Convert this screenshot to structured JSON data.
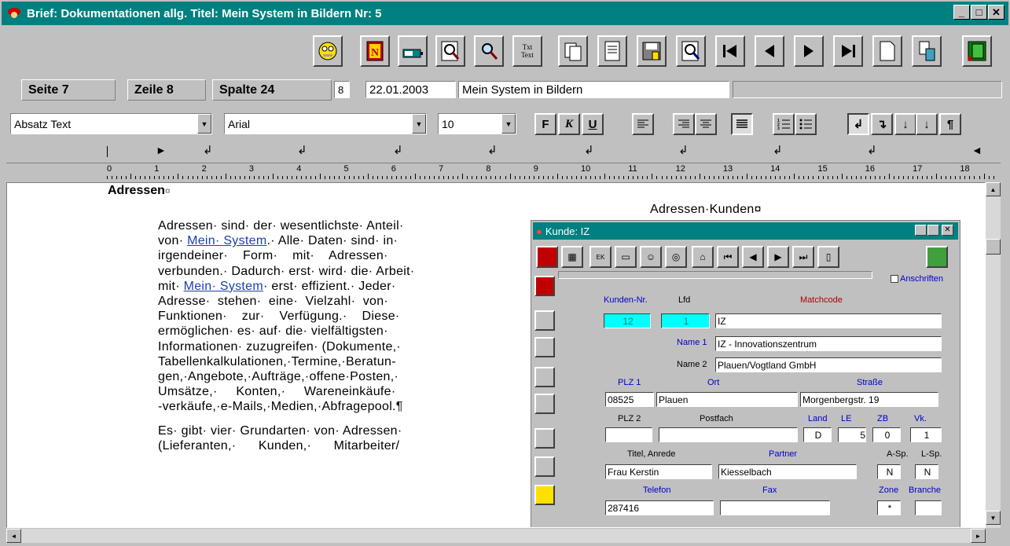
{
  "window": {
    "title": "Brief: Dokumentationen allg.  Titel: Mein System in Bildern  Nr: 5",
    "minimize": "_",
    "maximize": "□",
    "close": "✕"
  },
  "toolbar": {
    "icons": [
      "face-icon",
      "n-icon",
      "battery-icon",
      "zoom-doc-icon",
      "magnifier-icon",
      "text-icon",
      "copy-icon",
      "document-icon",
      "save-doc-icon",
      "search-doc-icon",
      "first-icon",
      "prev-icon",
      "next-icon",
      "last-icon",
      "new-doc-icon",
      "trash-icon",
      "exit-icon"
    ],
    "text_icon_label": "Txt Text"
  },
  "status": {
    "seite_label": "Seite  7",
    "zeile_label": "Zeile  8",
    "spalte_label": "Spalte  24",
    "small_value": "8",
    "date": "22.01.2003",
    "title_value": "Mein System in Bildern"
  },
  "format": {
    "style": "Absatz Text",
    "font": "Arial",
    "size": "10",
    "bold": "F",
    "italic": "K",
    "underline": "U",
    "pilcrow": "¶"
  },
  "ruler": {
    "numbers": [
      "0",
      "1",
      "2",
      "3",
      "4",
      "5",
      "6",
      "7",
      "8",
      "9",
      "10",
      "11",
      "12",
      "13",
      "14",
      "15",
      "16",
      "17",
      "18"
    ]
  },
  "document": {
    "heading": "Adressen",
    "heading_mark": "¤",
    "para1_lines": [
      [
        "Adressen· sind· der· wesentlichste· Anteil·"
      ],
      [
        "von· ",
        "Mein· System",
        ".· Alle· Daten· sind· in·"
      ],
      [
        "irgendeiner·    Form·    mit·    Adressen·"
      ],
      [
        "verbunden.· Dadurch· erst· wird· die· Arbeit·"
      ],
      [
        "mit· ",
        "Mein· System",
        "· erst· effizient.· Jeder·"
      ],
      [
        "Adresse·  stehen·  eine·  Vielzahl·  von·"
      ],
      [
        "Funktionen·    zur·    Verfügung.·    Diese·"
      ],
      [
        "ermöglichen· es· auf· die· vielfältigsten·"
      ],
      [
        "Informationen· zuzugreifen· (Dokumente,·"
      ],
      [
        "Tabellenkalkulationen,·Termine,·Beratun-"
      ],
      [
        "gen,·Angebote,·Aufträge,·offene·Posten,·"
      ],
      [
        "Umsätze,·     Konten,·     Wareneinkäufe·"
      ],
      [
        "-verkäufe,·e-Mails,·Medien,·Abfragepool.¶"
      ]
    ],
    "para2_lines": [
      "Es· gibt· vier· Grundarten· von· Adressen·",
      "(Lieferanten,·      Kunden,·      Mitarbeiter/"
    ],
    "image_caption": "Adressen·Kunden¤"
  },
  "subwindow": {
    "title": "Kunde: IZ",
    "anschriften": "Anschriften",
    "labels": {
      "kundennr": "Kunden-Nr.",
      "lfd": "Lfd",
      "matchcode": "Matchcode",
      "name1": "Name 1",
      "name2": "Name 2",
      "plz1": "PLZ 1",
      "ort": "Ort",
      "strasse": "Straße",
      "plz2": "PLZ 2",
      "postfach": "Postfach",
      "land": "Land",
      "le": "LE",
      "zb": "ZB",
      "vk": "Vk.",
      "titel": "Titel, Anrede",
      "partner": "Partner",
      "asp": "A-Sp.",
      "lsp": "L-Sp.",
      "telefon": "Telefon",
      "fax": "Fax",
      "zone": "Zone",
      "branche": "Branche"
    },
    "values": {
      "kundennr": "12",
      "lfd": "1",
      "matchcode": "IZ",
      "name1": "IZ - Innovationszentrum",
      "name2": "Plauen/Vogtland GmbH",
      "plz1": "08525",
      "ort": "Plauen",
      "strasse": "Morgenbergstr. 19",
      "land": "D",
      "le": "5",
      "zb": "0",
      "vk": "1",
      "titel": "Frau Kerstin",
      "partner": "Kiesselbach",
      "asp": "N",
      "lsp": "N",
      "telefon": "287416",
      "zone": "*"
    }
  },
  "colors": {
    "titlebar": "#008080",
    "link": "#1a3fb0",
    "cyan_field": "#00ffff"
  }
}
